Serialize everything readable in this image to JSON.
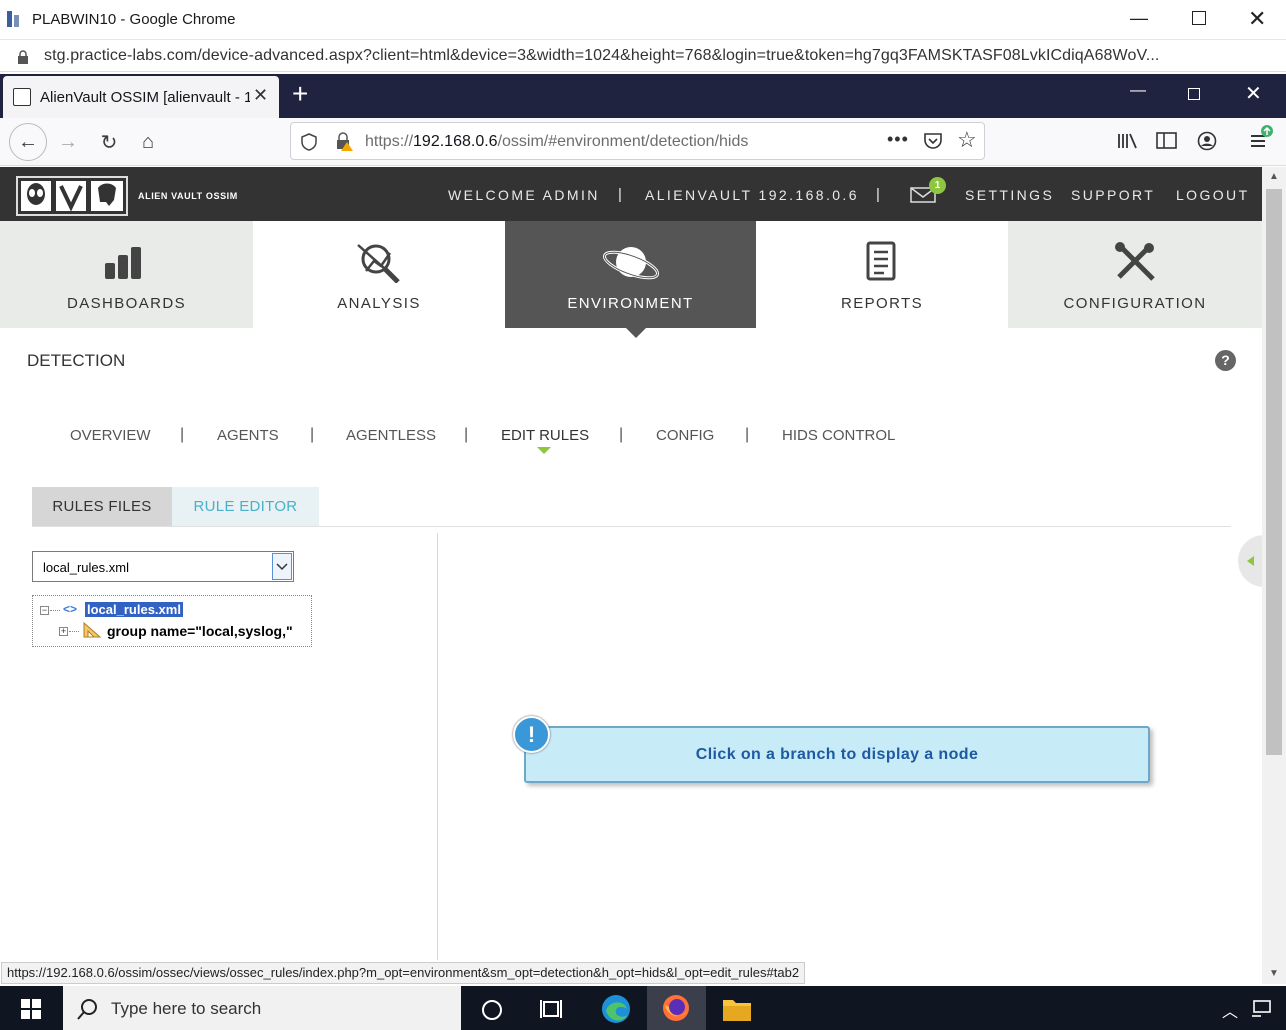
{
  "chrome": {
    "window_title": "PLABWIN10 - Google Chrome",
    "url": "stg.practice-labs.com/device-advanced.aspx?client=html&device=3&width=1024&height=768&login=true&token=hg7gq3FAMSKTASF08LvkICdiqA68WoV..."
  },
  "firefox": {
    "tab_title": "AlienVault OSSIM [alienvault - 1",
    "url_prefix": "https://",
    "url_host": "192.168.0.6",
    "url_path": "/ossim/#environment/detection/hids"
  },
  "header": {
    "logo_text": "ALIEN VAULT OSSIM",
    "welcome": "WELCOME ADMIN",
    "host": "ALIENVAULT 192.168.0.6",
    "mail_badge": "1",
    "settings": "SETTINGS",
    "support": "SUPPORT",
    "logout": "LOGOUT"
  },
  "mainnav": {
    "dashboards": "DASHBOARDS",
    "analysis": "ANALYSIS",
    "environment": "ENVIRONMENT",
    "reports": "REPORTS",
    "configuration": "CONFIGURATION"
  },
  "detection": {
    "title": "DETECTION",
    "help": "?",
    "subnav": {
      "overview": "OVERVIEW",
      "agents": "AGENTS",
      "agentless": "AGENTLESS",
      "edit_rules": "EDIT RULES",
      "config": "CONFIG",
      "hids_control": "HIDS CONTROL",
      "separator": "|"
    },
    "tabs": {
      "rules_files": "RULES FILES",
      "rule_editor": "RULE EDITOR"
    },
    "select_value": "local_rules.xml",
    "tree": {
      "root": "local_rules.xml",
      "child": "group name=\"local,syslog,\"",
      "root_toggle": "−",
      "child_toggle": "+"
    },
    "info_icon": "!",
    "info_message": "Click on a branch to display a node"
  },
  "statusbar": "https://192.168.0.6/ossim/ossec/views/ossec_rules/index.php?m_opt=environment&sm_opt=detection&h_opt=hids&l_opt=edit_rules#tab2",
  "taskbar": {
    "search_placeholder": "Type here to search"
  }
}
